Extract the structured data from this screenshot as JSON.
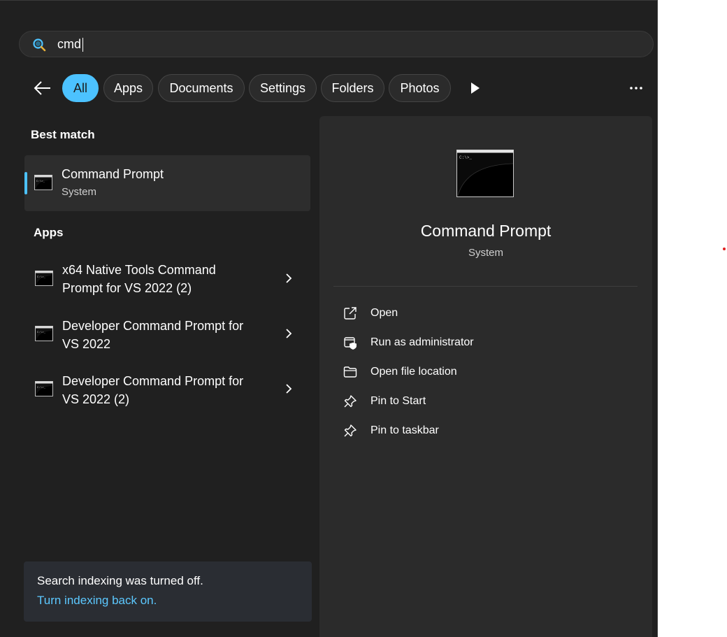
{
  "search": {
    "value": "cmd",
    "placeholder": ""
  },
  "filters": {
    "items": [
      {
        "label": "All",
        "active": true
      },
      {
        "label": "Apps",
        "active": false
      },
      {
        "label": "Documents",
        "active": false
      },
      {
        "label": "Settings",
        "active": false
      },
      {
        "label": "Folders",
        "active": false
      },
      {
        "label": "Photos",
        "active": false
      }
    ],
    "icons": {
      "back": "back-arrow-icon",
      "play": "play-icon",
      "more": "more-icon"
    }
  },
  "best_match": {
    "heading": "Best match",
    "title": "Command Prompt",
    "subtitle": "System",
    "icon": "command-prompt-icon"
  },
  "apps": {
    "heading": "Apps",
    "items": [
      {
        "title_line1": "x64 Native Tools Command",
        "title_line2": "Prompt for VS 2022 (2)"
      },
      {
        "title_line1": "Developer Command Prompt for",
        "title_line2": "VS 2022"
      },
      {
        "title_line1": "Developer Command Prompt for",
        "title_line2": "VS 2022 (2)"
      }
    ]
  },
  "notice": {
    "text": "Search indexing was turned off.",
    "link": "Turn indexing back on."
  },
  "detail": {
    "title": "Command Prompt",
    "subtitle": "System",
    "actions": [
      {
        "label": "Open",
        "icon": "open-external-icon"
      },
      {
        "label": "Run as administrator",
        "icon": "shield-icon"
      },
      {
        "label": "Open file location",
        "icon": "folder-icon"
      },
      {
        "label": "Pin to Start",
        "icon": "pin-icon"
      },
      {
        "label": "Pin to taskbar",
        "icon": "pin-icon"
      }
    ]
  },
  "colors": {
    "accent": "#4cc2ff",
    "panel": "#202020",
    "card": "#2b2b2b",
    "link": "#5cc8ff"
  }
}
